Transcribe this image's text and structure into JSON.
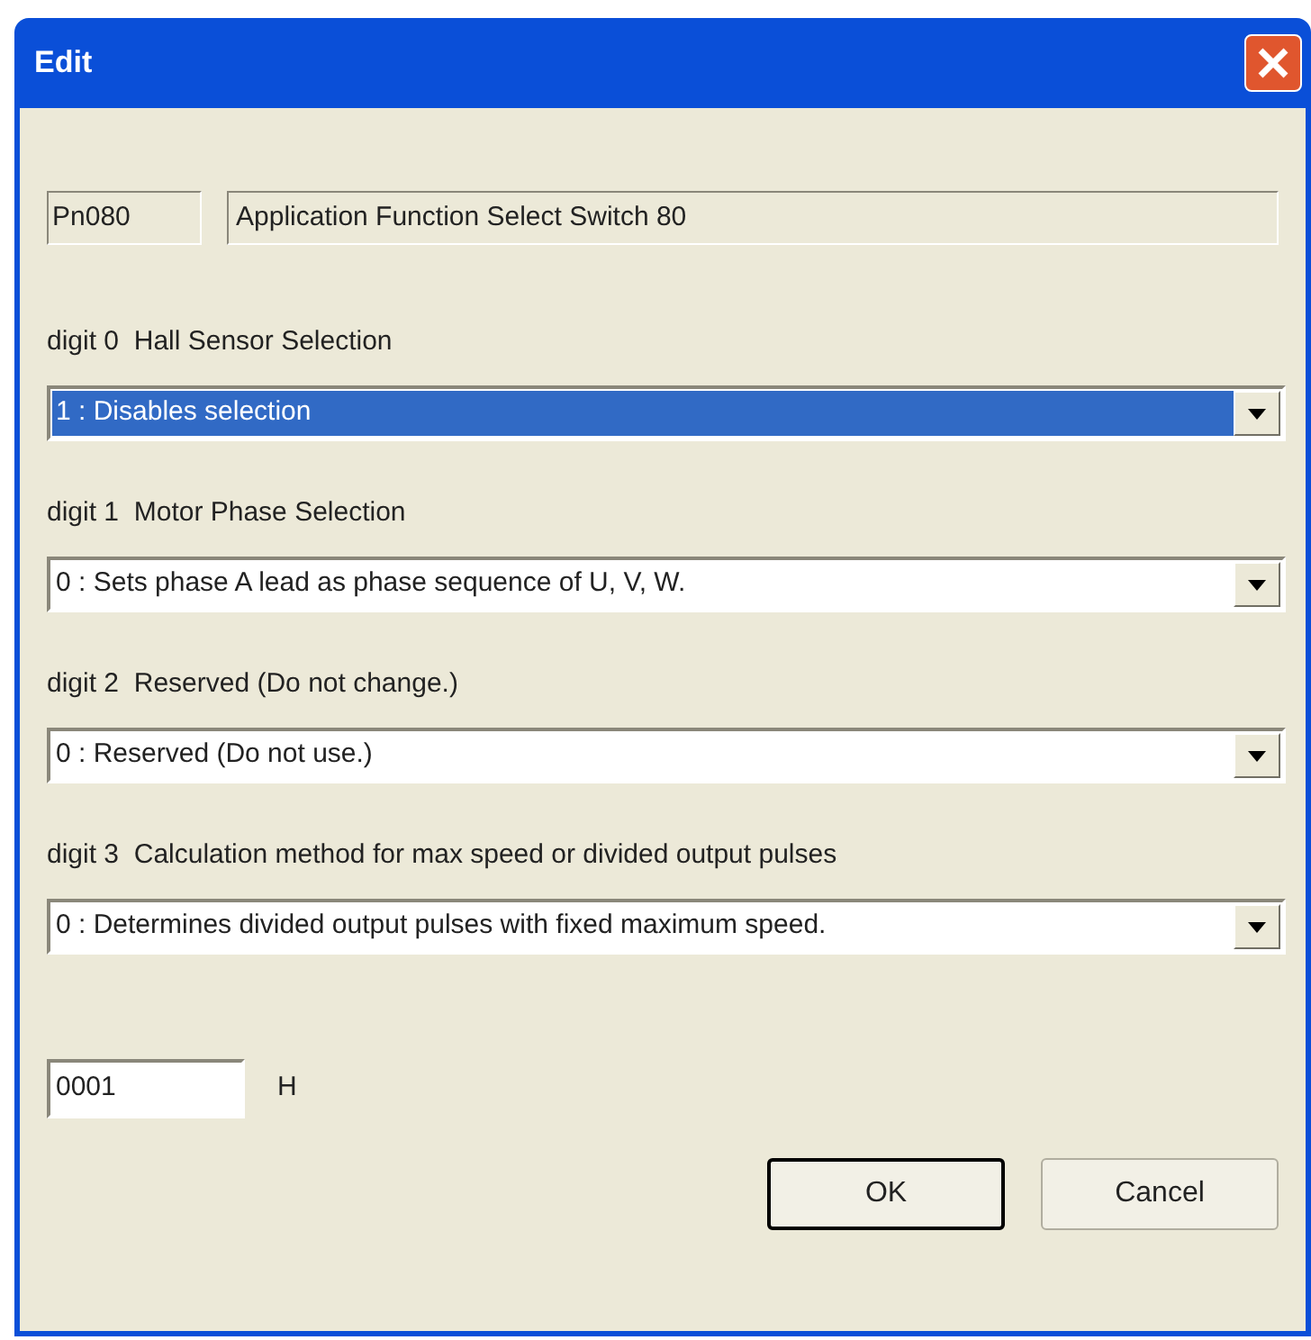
{
  "window": {
    "title": "Edit"
  },
  "parameter": {
    "number": "Pn080",
    "name": "Application Function Select Switch 80"
  },
  "digits": [
    {
      "label": "digit 0  Hall Sensor Selection",
      "value": "1 : Disables selection",
      "focused": true
    },
    {
      "label": "digit 1  Motor Phase Selection",
      "value": "0 : Sets phase A lead as phase sequence of U, V, W.",
      "focused": false
    },
    {
      "label": "digit 2  Reserved (Do not change.)",
      "value": "0 : Reserved (Do not use.)",
      "focused": false
    },
    {
      "label": "digit 3  Calculation method for max speed or divided output pulses",
      "value": "0 : Determines divided output pulses with fixed maximum speed.",
      "focused": false
    }
  ],
  "hex_value": {
    "value": "0001",
    "unit": "H"
  },
  "buttons": [
    {
      "label": "OK",
      "default": true
    },
    {
      "label": "Cancel",
      "default": false
    }
  ]
}
